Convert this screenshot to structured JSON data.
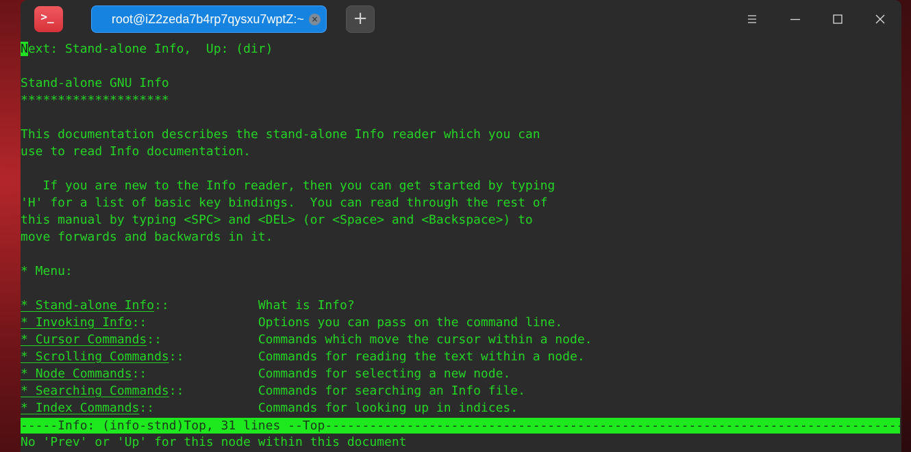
{
  "tab": {
    "title": "root@iZ2zeda7b4rp7qysxu7wptZ:~",
    "close_glyph": "×"
  },
  "new_tab_label": "+",
  "window_controls": {
    "menu": "☰",
    "minimize": "—",
    "maximize": "☐",
    "close": "✕"
  },
  "app_icon_glyph": ">_",
  "colors": {
    "text": "#25d425",
    "status_bg": "#1ee81e",
    "background": "#2b2b2b",
    "tab": "#1683e0"
  },
  "terminal": {
    "cursor_char": "N",
    "header_rest": "ext: Stand-alone Info,  Up: (dir)",
    "title": "Stand-alone GNU Info",
    "title_rule": "********************",
    "p1_l1": "This documentation describes the stand-alone Info reader which you can",
    "p1_l2": "use to read Info documentation.",
    "p2_l1": "   If you are new to the Info reader, then you can get started by typing",
    "p2_l2": "'H' for a list of basic key bindings.  You can read through the rest of",
    "p2_l3": "this manual by typing <SPC> and <DEL> (or <Space> and <Backspace>) to",
    "p2_l4": "move forwards and backwards in it.",
    "menu_heading": "* Menu:",
    "menu": [
      {
        "name": "Stand-alone Info",
        "pad": "            ",
        "desc": "What is Info?"
      },
      {
        "name": "Invoking Info",
        "pad": "               ",
        "desc": "Options you can pass on the command line."
      },
      {
        "name": "Cursor Commands",
        "pad": "             ",
        "desc": "Commands which move the cursor within a node."
      },
      {
        "name": "Scrolling Commands",
        "pad": "          ",
        "desc": "Commands for reading the text within a node."
      },
      {
        "name": "Node Commands",
        "pad": "               ",
        "desc": "Commands for selecting a new node."
      },
      {
        "name": "Searching Commands",
        "pad": "          ",
        "desc": "Commands for searching an Info file."
      },
      {
        "name": "Index Commands",
        "pad": "              ",
        "desc": "Commands for looking up in indices."
      }
    ],
    "status_line": "-----Info: (info-stnd)Top, 31 lines --Top-----------------------------------------------------------------------------------------",
    "echo_line": "No 'Prev' or 'Up' for this node within this document"
  }
}
